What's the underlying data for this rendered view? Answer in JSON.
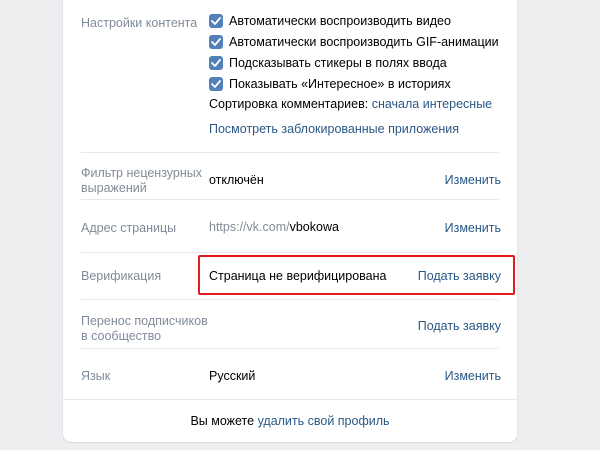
{
  "content_settings": {
    "label": "Настройки контента",
    "checkboxes": [
      {
        "label": "Автоматически воспроизводить видео",
        "checked": true
      },
      {
        "label": "Автоматически воспроизводить GIF-анимации",
        "checked": true
      },
      {
        "label": "Подсказывать стикеры в полях ввода",
        "checked": true
      },
      {
        "label": "Показывать «Интересное» в историях",
        "checked": true
      }
    ],
    "sort_label": "Сортировка комментариев:",
    "sort_value": "сначала интересные",
    "blocked_apps_link": "Посмотреть заблокированные приложения"
  },
  "obscene_filter": {
    "label_line1": "Фильтр нецензурных",
    "label_line2": "выражений",
    "value": "отключён",
    "action": "Изменить"
  },
  "page_address": {
    "label": "Адрес страницы",
    "prefix": "https://vk.com/",
    "slug": "vbokowa",
    "action": "Изменить"
  },
  "verification": {
    "label": "Верификация",
    "value": "Страница не верифицирована",
    "action": "Подать заявку"
  },
  "subscribers_transfer": {
    "label_line1": "Перенос подписчиков",
    "label_line2": "в сообщество",
    "action": "Подать заявку"
  },
  "language": {
    "label": "Язык",
    "value": "Русский",
    "action": "Изменить"
  },
  "footer": {
    "text": "Вы можете",
    "link": "удалить свой профиль"
  },
  "colors": {
    "accent": "#2a5885",
    "checkbox": "#5181b8",
    "highlight": "#e21c1c"
  }
}
